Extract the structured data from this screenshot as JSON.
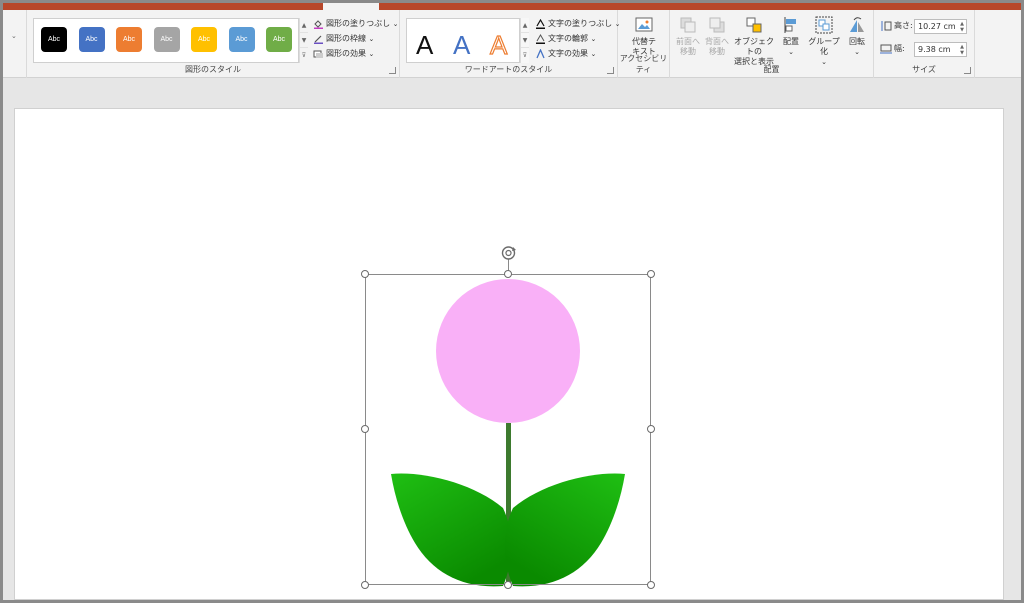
{
  "shape_styles": {
    "label": "図形のスタイル",
    "presets": [
      {
        "text": "Abc",
        "color": "#000000"
      },
      {
        "text": "Abc",
        "color": "#4472c4"
      },
      {
        "text": "Abc",
        "color": "#ed7d31"
      },
      {
        "text": "Abc",
        "color": "#a5a5a5"
      },
      {
        "text": "Abc",
        "color": "#ffc000"
      },
      {
        "text": "Abc",
        "color": "#5b9bd5"
      },
      {
        "text": "Abc",
        "color": "#70ad47"
      }
    ],
    "fill_label": "図形の塗りつぶし",
    "outline_label": "図形の枠線",
    "effects_label": "図形の効果"
  },
  "wordart_styles": {
    "label": "ワードアートのスタイル",
    "letters": [
      "A",
      "A",
      "A"
    ],
    "text_fill_label": "文字の塗りつぶし",
    "text_outline_label": "文字の輪郭",
    "text_effects_label": "文字の効果"
  },
  "accessibility": {
    "label": "アクセシビリティ",
    "alt_text_line1": "代替テ",
    "alt_text_line2": "キスト"
  },
  "arrange": {
    "label": "配置",
    "bring_forward_line1": "前面へ",
    "bring_forward_line2": "移動",
    "send_backward_line1": "背面へ",
    "send_backward_line2": "移動",
    "selection_pane_line1": "オブジェクトの",
    "selection_pane_line2": "選択と表示",
    "align_label": "配置",
    "group_label": "グループ化",
    "rotate_label": "回転"
  },
  "size": {
    "label": "サイズ",
    "height_label": "高さ:",
    "height_value": "10.27 cm",
    "width_label": "幅:",
    "width_value": "9.38 cm"
  },
  "colors": {
    "accent": "#b7472a",
    "petal": "#f9b0f7",
    "stem": "#3d7a2e",
    "leaf_light": "#1fbf13",
    "leaf_dark": "#0a8a00"
  }
}
